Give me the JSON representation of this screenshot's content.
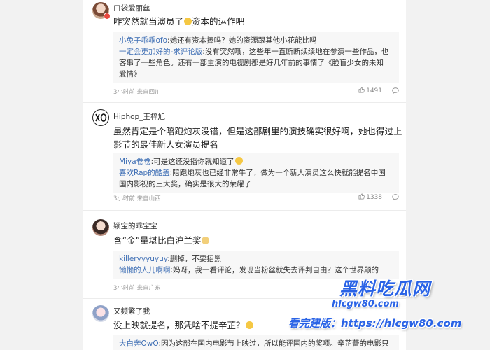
{
  "comments": [
    {
      "username": "口袋爱丽丝",
      "text": "咋突然就当演员了",
      "text_after_emoji": "资本的运作吧",
      "replies": [
        {
          "user": "小兔子乖乖ofo",
          "text": ":她还有资本捧吗？她的资源跟其他小花能比吗"
        },
        {
          "user": "一定会更加好的-求评论版",
          "text": ":没有突然哦，这些年一直断断续续地在参演一些作品，也"
        },
        {
          "user": "",
          "text": "客串了一些角色。还有一部主演的电视剧都是好几年前的事情了《脸盲少女的未知"
        },
        {
          "user": "",
          "text": "爱情》"
        }
      ],
      "meta": "3小时前 来自四川",
      "likes": "1491"
    },
    {
      "username": "Hiphop_王梓旭",
      "text_line1": "虽然肯定是个陪跑炮灰没错，但是这部剧里的演技确实很好啊，她也得过上",
      "text_line2": "影节的最佳新人女演员提名",
      "replies": [
        {
          "user": "Miya卷卷",
          "text": ":可是这还没播你就知道了"
        },
        {
          "user": "喜欢Rap的酷盖",
          "text": ":陪跑炮灰也已经非常牛了，做为一个新人演员这么快就能提名中国"
        },
        {
          "user": "",
          "text": "国内影视的三大奖，确实是很大的荣耀了"
        }
      ],
      "meta": "3小时前 来自山西",
      "likes": "1338"
    },
    {
      "username": "颖宝的乖宝宝",
      "text": "含“金”量堪比白沪兰奖",
      "replies": [
        {
          "user": "killeryyyuyuy",
          "text": ":删掉，不要招黑"
        },
        {
          "user": "懒懒的人儿啊啊",
          "text": ":妈呀，我一看评论，发现当粉丝就失去评判自由？这个世界颠的"
        }
      ],
      "meta": "3小时前 来自广东"
    },
    {
      "username": "又频繁了我",
      "text": "没上映就提名，那凭啥不提辛芷？",
      "replies": [
        {
          "user": "大白奔OwO",
          "text": ":因为这部在国内电影节上映过，所以能评国内的奖项。辛芷蕾的电影只"
        }
      ]
    }
  ],
  "watermark": {
    "title": "黑料吃瓜网",
    "url": "hlcgw80.com",
    "line": "看完建版：https://hlcgw80.com"
  },
  "icons": {
    "like": "thumb-up-icon",
    "reply": "comment-bubble-icon",
    "verified": "verified-badge-icon"
  },
  "colors": {
    "link": "#3f6fb5",
    "watermark": "#2a63e6"
  }
}
